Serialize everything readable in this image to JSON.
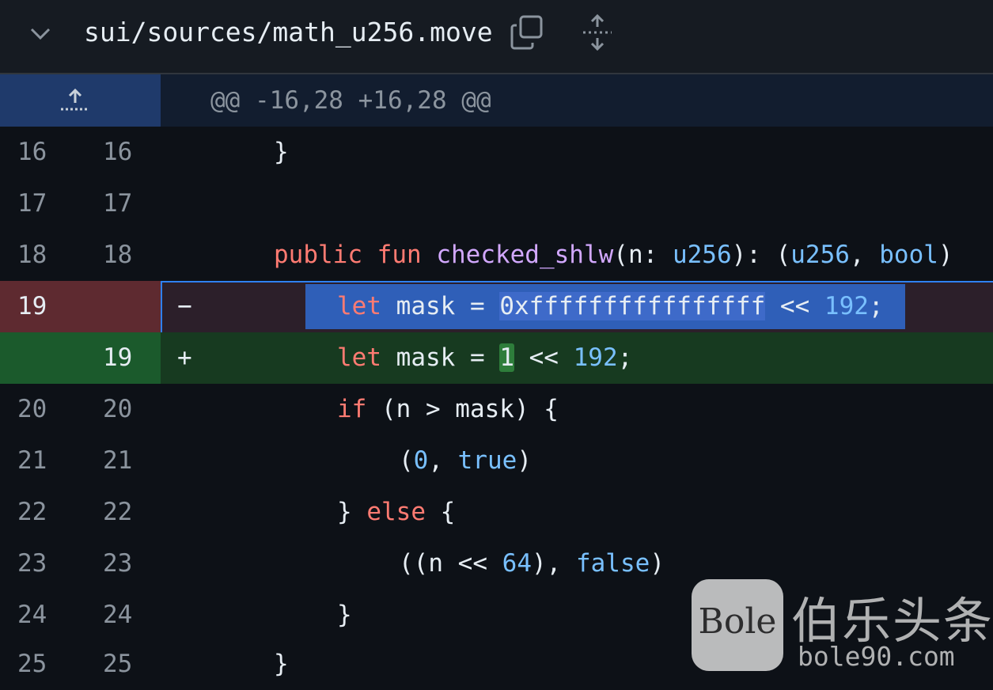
{
  "file": {
    "path": "sui/sources/math_u256.move",
    "icons": [
      "chevron-down-icon",
      "copy-icon",
      "expand-all-icon"
    ]
  },
  "hunk": {
    "header": "@@ -16,28 +16,28 @@",
    "icon": "expand-up-icon"
  },
  "lines": [
    {
      "old": "16",
      "new": "16",
      "marker": "",
      "type": "context"
    },
    {
      "old": "17",
      "new": "17",
      "marker": "",
      "type": "context"
    },
    {
      "old": "18",
      "new": "18",
      "marker": "",
      "type": "context"
    },
    {
      "old": "19",
      "new": "",
      "marker": "−",
      "type": "deletion"
    },
    {
      "old": "",
      "new": "19",
      "marker": "+",
      "type": "addition"
    },
    {
      "old": "20",
      "new": "20",
      "marker": "",
      "type": "context"
    },
    {
      "old": "21",
      "new": "21",
      "marker": "",
      "type": "context"
    },
    {
      "old": "22",
      "new": "22",
      "marker": "",
      "type": "context"
    },
    {
      "old": "23",
      "new": "23",
      "marker": "",
      "type": "context"
    },
    {
      "old": "24",
      "new": "24",
      "marker": "",
      "type": "context"
    },
    {
      "old": "25",
      "new": "25",
      "marker": "",
      "type": "context"
    }
  ],
  "code": {
    "l16": {
      "text": "}"
    },
    "l18": {
      "kw_public": "public",
      "kw_fun": "fun",
      "fn_name": "checked_shlw",
      "p1": "(n: ",
      "ty1": "u256",
      "p2": "): (",
      "ty2": "u256",
      "p3": ", ",
      "ty3": "bool",
      "p4": ")"
    },
    "l19_del": {
      "kw": "let",
      "t1": " mask = ",
      "hl": "0xffffffffffffffff",
      "t2": " << ",
      "num": "192",
      "t3": ";"
    },
    "l19_add": {
      "kw": "let",
      "t1": " mask = ",
      "hl": "1",
      "t2": " << ",
      "num": "192",
      "t3": ";"
    },
    "l20": {
      "kw": "if",
      "t1": " (n > mask) {"
    },
    "l21": {
      "t1": "(",
      "n0": "0",
      "t2": ", ",
      "kw": "true",
      "t3": ")"
    },
    "l22": {
      "t1": "} ",
      "kw": "else",
      "t2": " {"
    },
    "l23": {
      "t1": "((n << ",
      "n64": "64",
      "t2": "), ",
      "kw": "false",
      "t3": ")"
    },
    "l24": {
      "text": "}"
    },
    "l25": {
      "text": "}"
    }
  },
  "watermark": {
    "logo_text": "Bole",
    "title": "伯乐头条",
    "url": "bole90.com"
  },
  "colors": {
    "background": "#0d1117",
    "deletion_gutter": "#5e2a30",
    "addition_gutter": "#1b5a2c",
    "selection_border": "#2f81f7",
    "keyword": "#ff7b72",
    "function": "#d2a8ff",
    "type": "#79c0ff"
  }
}
